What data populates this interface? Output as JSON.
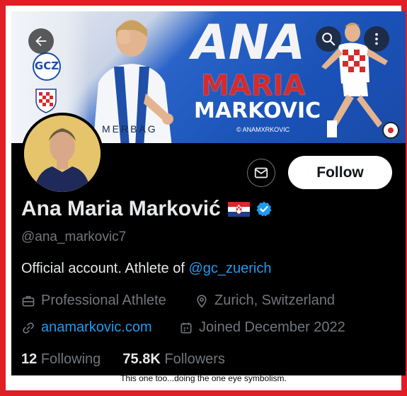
{
  "banner": {
    "name_line1": "ANA",
    "name_line2": "MARIA",
    "name_line3": "MARKOVIC",
    "handle_small": "© ANAMXRKOVIC",
    "sponsor": "MERBAG",
    "club_badge": "GCZ"
  },
  "profile": {
    "display_name": "Ana Maria Marković",
    "handle": "@ana_markovic7",
    "bio_prefix": "Official account. Athlete of ",
    "bio_mention": "@gc_zuerich",
    "category": "Professional Athlete",
    "location": "Zurich, Switzerland",
    "website": "anamarkovic.com",
    "joined": "Joined December 2022",
    "following_count": "12",
    "following_label": "Following",
    "followers_count": "75.8K",
    "followers_label": "Followers"
  },
  "actions": {
    "follow_label": "Follow"
  },
  "icons": {
    "back": "back-arrow-icon",
    "search": "search-icon",
    "more": "more-vertical-icon",
    "message": "envelope-icon",
    "verified": "verified-badge-icon",
    "flag": "croatia-flag-icon"
  },
  "colors": {
    "accent": "#1d9bf0",
    "frame": "#e01e25",
    "background": "#000000",
    "muted": "#71767b"
  },
  "caption": "This one too...doing the one eye symbolism."
}
